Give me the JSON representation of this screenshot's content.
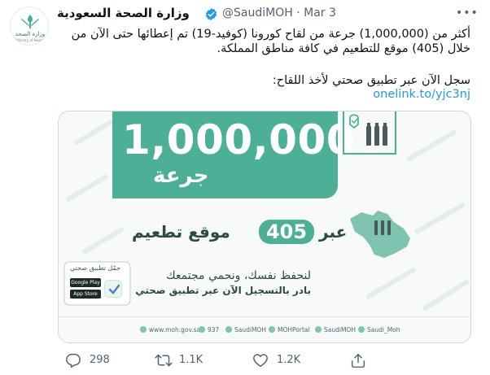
{
  "tweet": {
    "author_name": "وزارة الصحة السعودية",
    "handle": "@SaudiMOH",
    "separator": "·",
    "date": "Mar 3",
    "text_line1": "أكثر من (1,000,000) جرعة من لقاح كورونا (كوفيد-19) تم إعطائها حتى الآن من",
    "text_line2": "خلال (405) موقع للتطعيم في كافة مناطق المملكة.",
    "text_line3": "سجل الآن عبر تطبيق صحتي لأخذ اللقاح:",
    "link": "onelink.to/yjc3nj",
    "avatar_logo_text": "وزارة الصحة",
    "avatar_logo_subtext": "Ministry of Health"
  },
  "card": {
    "doses_number": "1,000,000",
    "doses_label": "جرعة",
    "sites_prefix": "عبر",
    "sites_number": "405",
    "sites_label": "موقع تطعيم",
    "slogan_line1": "لنحفظ نفسك، ونحمي مجتمعك",
    "slogan_line2": "بادر بالتسجيل الآن عبر تطبيق صحتي",
    "app_label": "حمّل تطبيق صحتي",
    "google_play": "Google Play",
    "app_store": "App Store",
    "footer": {
      "website": "www.moh.gov.sa",
      "phone": "937",
      "twitter": "SaudiMOH",
      "portal": "MOHPortal",
      "snap": "SaudiMOH",
      "insta": "Saudi_Moh"
    }
  },
  "actions": {
    "replies": "298",
    "retweets": "1.1K",
    "likes": "1.2K"
  },
  "colors": {
    "brand_green": "#4cb096",
    "link_blue": "#1d9bf0",
    "verified_blue": "#1d9bf0",
    "muted_text": "#536471"
  },
  "icons": [
    "verified-badge-icon",
    "more-icon",
    "reply-icon",
    "retweet-icon",
    "like-icon",
    "share-icon"
  ]
}
